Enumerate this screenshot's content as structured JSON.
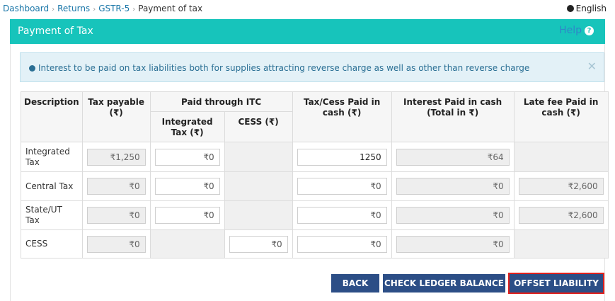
{
  "breadcrumb": {
    "items": [
      "Dashboard",
      "Returns",
      "GSTR-5"
    ],
    "current": "Payment of tax"
  },
  "language": {
    "label": "English"
  },
  "page": {
    "title": "Payment of Tax",
    "help_label": "Help"
  },
  "alert": {
    "message": "Interest to be paid on tax liabilities both for supplies attracting reverse charge as well as other than reverse charge"
  },
  "table": {
    "headers": {
      "description": "Description",
      "tax_payable": "Tax payable (₹)",
      "paid_through_itc": "Paid through ITC",
      "integrated_tax": "Integrated Tax (₹)",
      "cess": "CESS (₹)",
      "tax_cess_cash": "Tax/Cess Paid in cash (₹)",
      "interest_cash": "Interest Paid in cash (Total in ₹)",
      "late_fee": "Late fee Paid in cash (₹)"
    },
    "rows": [
      {
        "label": "Integrated Tax",
        "tax_payable": "₹1,250",
        "itc_integrated": "₹0",
        "tax_cash": "1250",
        "interest": "₹64"
      },
      {
        "label": "Central Tax",
        "tax_payable": "₹0",
        "itc_integrated": "₹0",
        "tax_cash": "₹0",
        "interest": "₹0",
        "late_fee": "₹2,600"
      },
      {
        "label": "State/UT Tax",
        "tax_payable": "₹0",
        "itc_integrated": "₹0",
        "tax_cash": "₹0",
        "interest": "₹0",
        "late_fee": "₹2,600"
      },
      {
        "label": "CESS",
        "tax_payable": "₹0",
        "itc_cess": "₹0",
        "tax_cash": "₹0",
        "interest": "₹0"
      }
    ]
  },
  "buttons": {
    "back": "BACK",
    "check_ledger": "CHECK LEDGER BALANCE",
    "offset": "OFFSET LIABILITY"
  }
}
